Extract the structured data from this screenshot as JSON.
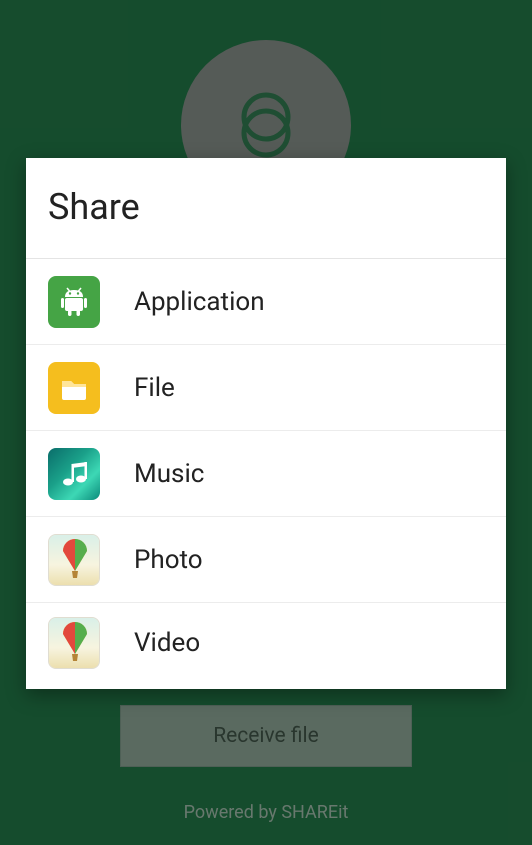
{
  "background": {
    "receive_button_label": "Receive file",
    "footer_text": "Powered by SHAREit"
  },
  "dialog": {
    "title": "Share",
    "items": [
      {
        "label": "Application",
        "icon": "android-icon"
      },
      {
        "label": "File",
        "icon": "folder-icon"
      },
      {
        "label": "Music",
        "icon": "music-note-icon"
      },
      {
        "label": "Photo",
        "icon": "balloon-icon"
      },
      {
        "label": "Video",
        "icon": "balloon-icon"
      }
    ]
  }
}
